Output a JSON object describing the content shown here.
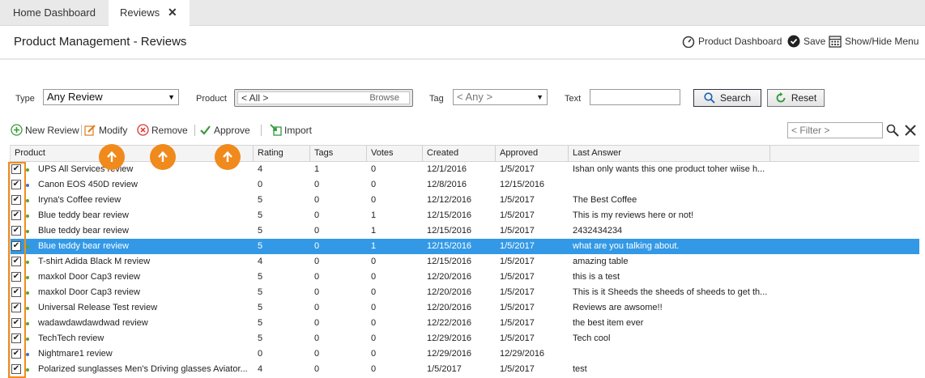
{
  "tabs": [
    {
      "label": "Home Dashboard"
    },
    {
      "label": "Reviews",
      "close": "✕"
    }
  ],
  "header": {
    "title": "Product Management - Reviews",
    "product_dashboard": "Product Dashboard",
    "save": "Save",
    "show_hide_menu": "Show/Hide Menu"
  },
  "filters": {
    "type_label": "Type",
    "type_value": "Any Review",
    "product_label": "Product",
    "product_value": "< All >",
    "browse": "Browse",
    "tag_label": "Tag",
    "tag_value": "< Any >",
    "text_label": "Text",
    "text_value": "",
    "search": "Search",
    "reset": "Reset"
  },
  "toolbar": {
    "new_review": "New Review",
    "modify": "Modify",
    "remove": "Remove",
    "approve": "Approve",
    "import": "Import",
    "filter_placeholder": "< Filter >"
  },
  "columns": [
    "Product",
    "Rating",
    "Tags",
    "Votes",
    "Created",
    "Approved",
    "Last Answer"
  ],
  "rows": [
    {
      "product": "UPS All Services review",
      "rating": "4",
      "tags": "1",
      "votes": "0",
      "created": "12/1/2016",
      "approved": "1/5/2017",
      "last_answer": "Ishan only wants this one product toher wiise h...",
      "dot": "green"
    },
    {
      "product": "Canon EOS 450D review",
      "rating": "0",
      "tags": "0",
      "votes": "0",
      "created": "12/8/2016",
      "approved": "12/15/2016",
      "last_answer": "",
      "dot": "blue"
    },
    {
      "product": "Iryna's Coffee review",
      "rating": "5",
      "tags": "0",
      "votes": "0",
      "created": "12/12/2016",
      "approved": "1/5/2017",
      "last_answer": "The Best Coffee",
      "dot": "green"
    },
    {
      "product": "Blue teddy bear review",
      "rating": "5",
      "tags": "0",
      "votes": "1",
      "created": "12/15/2016",
      "approved": "1/5/2017",
      "last_answer": "This is my reviews here or not!",
      "dot": "green"
    },
    {
      "product": "Blue teddy bear review",
      "rating": "5",
      "tags": "0",
      "votes": "1",
      "created": "12/15/2016",
      "approved": "1/5/2017",
      "last_answer": "2432434234",
      "dot": "green"
    },
    {
      "product": "Blue teddy bear review",
      "rating": "5",
      "tags": "0",
      "votes": "1",
      "created": "12/15/2016",
      "approved": "1/5/2017",
      "last_answer": "what are you talking about.",
      "dot": "green",
      "selected": true
    },
    {
      "product": "T-shirt Adida Black M review",
      "rating": "4",
      "tags": "0",
      "votes": "0",
      "created": "12/15/2016",
      "approved": "1/5/2017",
      "last_answer": "amazing table",
      "dot": "green"
    },
    {
      "product": "maxkol Door Cap3 review",
      "rating": "5",
      "tags": "0",
      "votes": "0",
      "created": "12/20/2016",
      "approved": "1/5/2017",
      "last_answer": "this is a test",
      "dot": "green"
    },
    {
      "product": "maxkol Door Cap3 review",
      "rating": "5",
      "tags": "0",
      "votes": "0",
      "created": "12/20/2016",
      "approved": "1/5/2017",
      "last_answer": "This is it Sheeds the sheeds of sheeds to get th...",
      "dot": "green"
    },
    {
      "product": "Universal Release Test review",
      "rating": "5",
      "tags": "0",
      "votes": "0",
      "created": "12/20/2016",
      "approved": "1/5/2017",
      "last_answer": "Reviews are awsome!!",
      "dot": "green"
    },
    {
      "product": "wadawdawdawdwad review",
      "rating": "5",
      "tags": "0",
      "votes": "0",
      "created": "12/22/2016",
      "approved": "1/5/2017",
      "last_answer": "the best item ever",
      "dot": "green"
    },
    {
      "product": "TechTech review",
      "rating": "5",
      "tags": "0",
      "votes": "0",
      "created": "12/29/2016",
      "approved": "1/5/2017",
      "last_answer": "Tech cool",
      "dot": "green"
    },
    {
      "product": "Nightmare1 review",
      "rating": "0",
      "tags": "0",
      "votes": "0",
      "created": "12/29/2016",
      "approved": "12/29/2016",
      "last_answer": "",
      "dot": "blue"
    },
    {
      "product": "Polarized sunglasses Men's Driving glasses Aviator...",
      "rating": "4",
      "tags": "0",
      "votes": "0",
      "created": "1/5/2017",
      "approved": "1/5/2017",
      "last_answer": "test",
      "dot": "green"
    }
  ],
  "colors": {
    "accent": "#f08a1c",
    "selected_row": "#3399e6",
    "green_dot": "#5aa52a",
    "blue_dot": "#3b6fd0"
  },
  "check": "✔"
}
